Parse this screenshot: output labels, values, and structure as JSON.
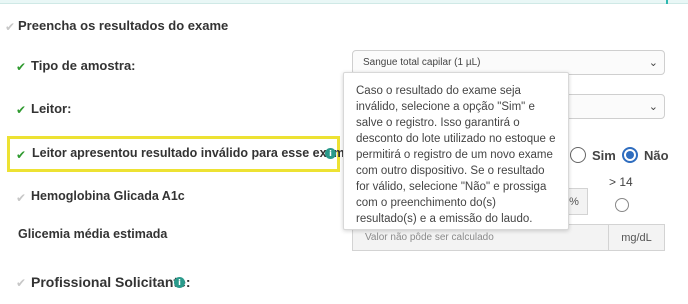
{
  "form": {
    "section_title": "Preencha os resultados do exame",
    "sample_type": {
      "label": "Tipo de amostra:",
      "selected": "Sangue total capilar (1 µL)"
    },
    "reader": {
      "label": "Leitor:",
      "selected": ""
    },
    "invalid_result": {
      "label": "Leitor apresentou resultado inválido para esse exame?",
      "option_yes": "Sim",
      "option_no": "Não",
      "selected": "Não"
    },
    "hba1c": {
      "label": "Hemoglobina Glicada A1c",
      "unit": "%",
      "range_option": "> 14"
    },
    "estimated_glucose": {
      "label": "Glicemia média estimada",
      "placeholder": "Valor não pôde ser calculado",
      "unit": "mg/dL"
    },
    "requesting_professional": {
      "label": "Profissional Solicitante:"
    }
  },
  "tooltip": {
    "text": "Caso o resultado do exame seja inválido, selecione a opção \"Sim\" e salve o registro. Isso garantirá o desconto do lote utilizado no estoque e permitirá o registro de um novo exame com outro dispositivo. Se o resultado for válido, selecione \"Não\" e prossiga com o preenchimento do(s) resultado(s) e a emissão do laudo."
  },
  "icons": {
    "check": "check-icon",
    "info": "info-icon",
    "chevron": "chevron-down-icon"
  },
  "colors": {
    "check_valid": "#2f9a2f",
    "check_pending": "#c7c7c7",
    "highlight": "#ede233",
    "radio_selected": "#2f6dbf",
    "info": "#2a9a8b",
    "accent": "#2cb8b0"
  }
}
